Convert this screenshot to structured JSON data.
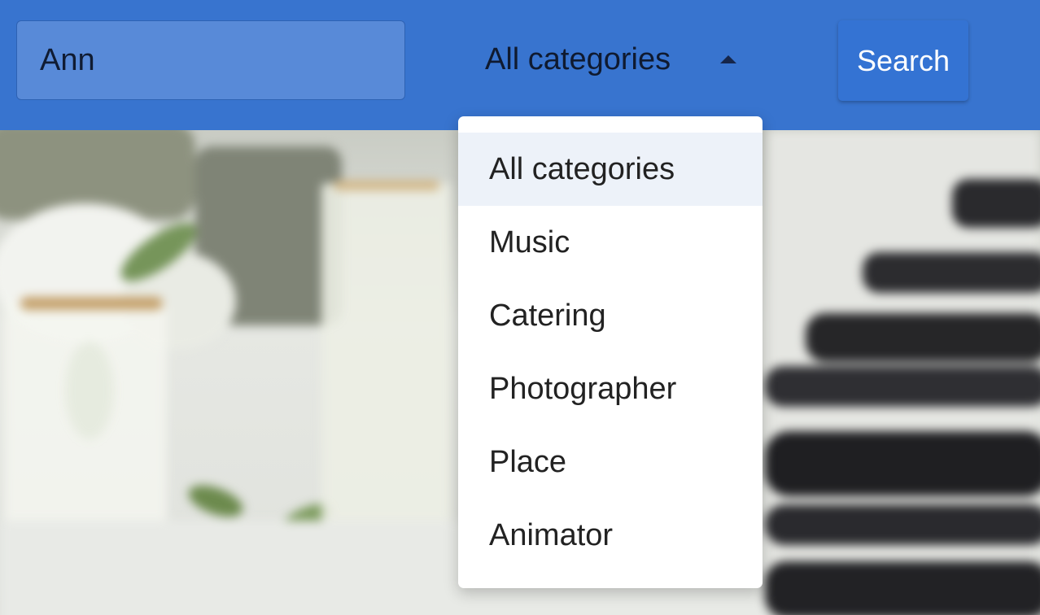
{
  "search": {
    "value": "Ann"
  },
  "category": {
    "selected": "All categories",
    "options": [
      "All categories",
      "Music",
      "Catering",
      "Photographer",
      "Place",
      "Animator"
    ]
  },
  "search_button": {
    "label": "Search"
  },
  "colors": {
    "header": "#3874cf",
    "input_bg": "#588ad8",
    "button_bg": "#3473d3",
    "selected_option_bg": "#edf2f9"
  },
  "icons": {
    "select_caret": "caret-up-icon"
  }
}
